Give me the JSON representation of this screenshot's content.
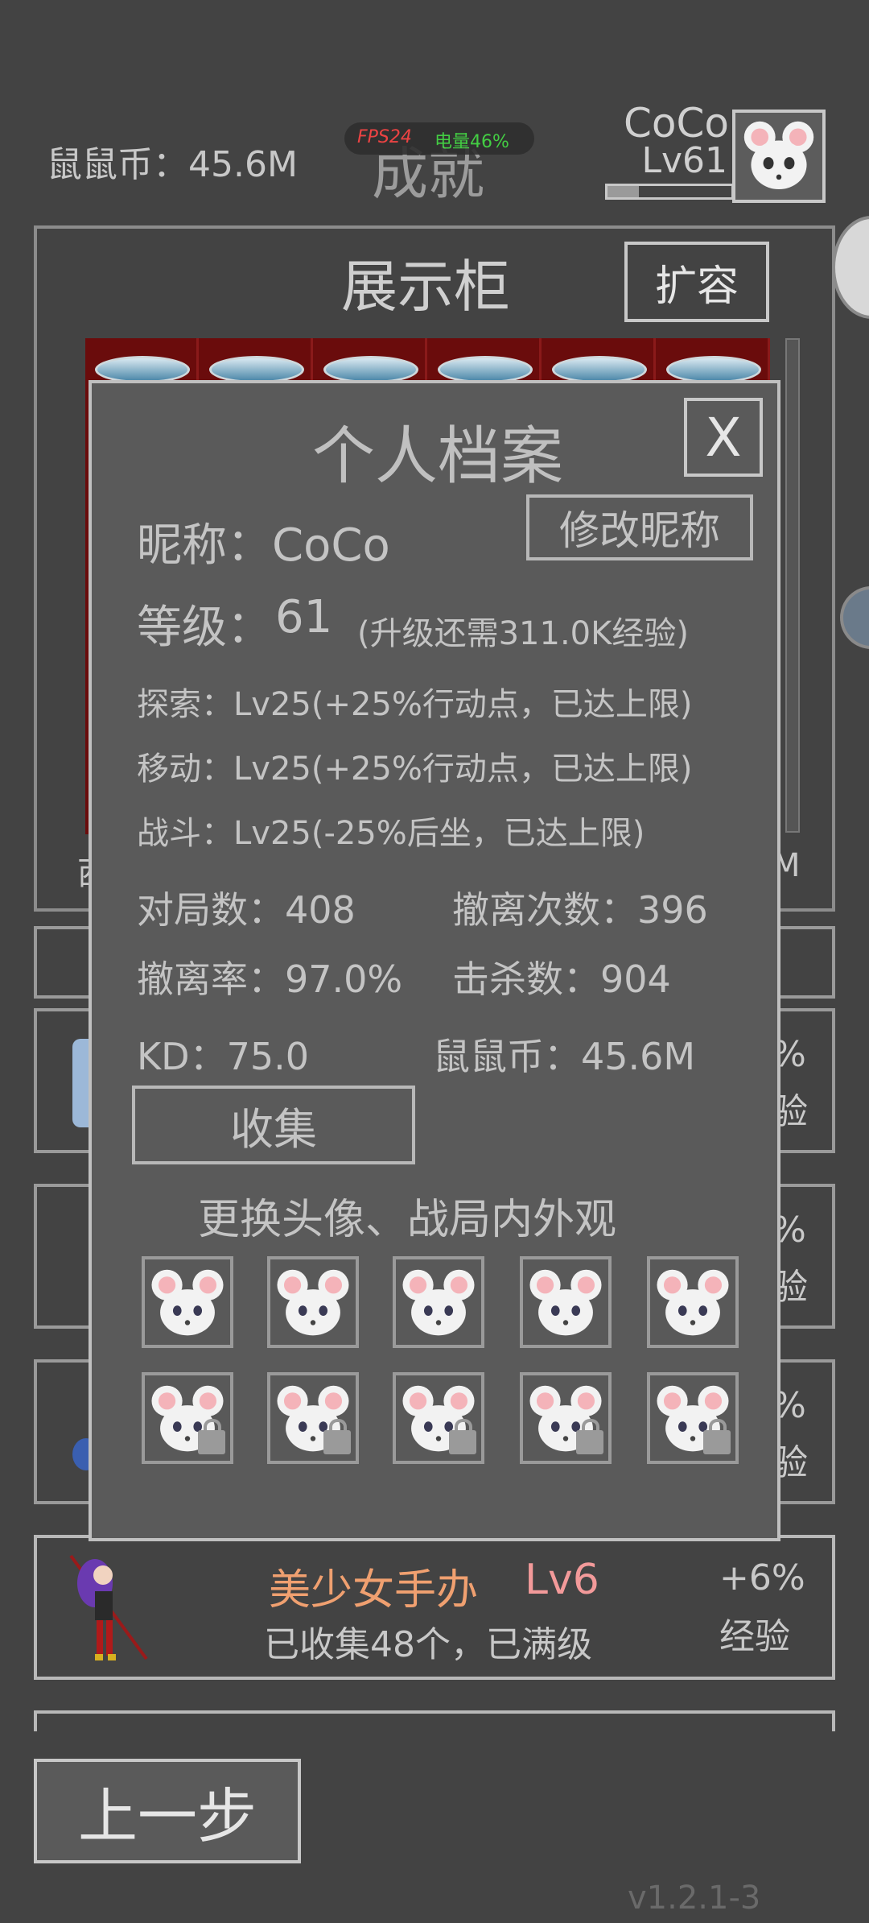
{
  "header": {
    "coins_label": "鼠鼠币：45.6M",
    "title": "成就",
    "fps": "FPS24",
    "battery": "电量46%",
    "player_name": "CoCo",
    "player_level": "Lv61",
    "level_progress": 0.25
  },
  "cabinet": {
    "title": "展示柜",
    "expand_button": "扩容",
    "bottom_left": "西",
    "bottom_right": "M"
  },
  "profile": {
    "title": "个人档案",
    "close": "X",
    "nickname": "昵称：CoCo",
    "rename_button": "修改昵称",
    "level_label": "等级：",
    "level_value": "61",
    "level_note": "(升级还需311.0K经验)",
    "explore": "探索：Lv25(+25%行动点，已达上限)",
    "move": "移动：Lv25(+25%行动点，已达上限)",
    "combat": "战斗：Lv25(-25%后坐，已达上限)",
    "matches": "对局数：408",
    "evacuations": "撤离次数：396",
    "evac_rate": "撤离率：97.0%",
    "kills": "击杀数：904",
    "kd": "KD：75.0",
    "coins": "鼠鼠币：45.6M",
    "collect_button": "收集",
    "avatar_heading": "更换头像、战局内外观"
  },
  "behind_cards": [
    {
      "line1": "%",
      "line2": "验"
    },
    {
      "line1": "%",
      "line2": "验"
    },
    {
      "line1": "%",
      "line2": "验"
    }
  ],
  "figure_card": {
    "name": "美少女手办",
    "level": "Lv6",
    "desc": "已收集48个，已满级",
    "bonus": "+6%",
    "bonus_label": "经验"
  },
  "footer": {
    "back_button": "上一步",
    "version": "v1.2.1-3"
  },
  "colors": {
    "background": "#434343",
    "panel": "#595959",
    "figure_name": "#f0a070",
    "figure_level": "#f39a9a",
    "fps": "#ff4444",
    "battery": "#44dd44"
  }
}
